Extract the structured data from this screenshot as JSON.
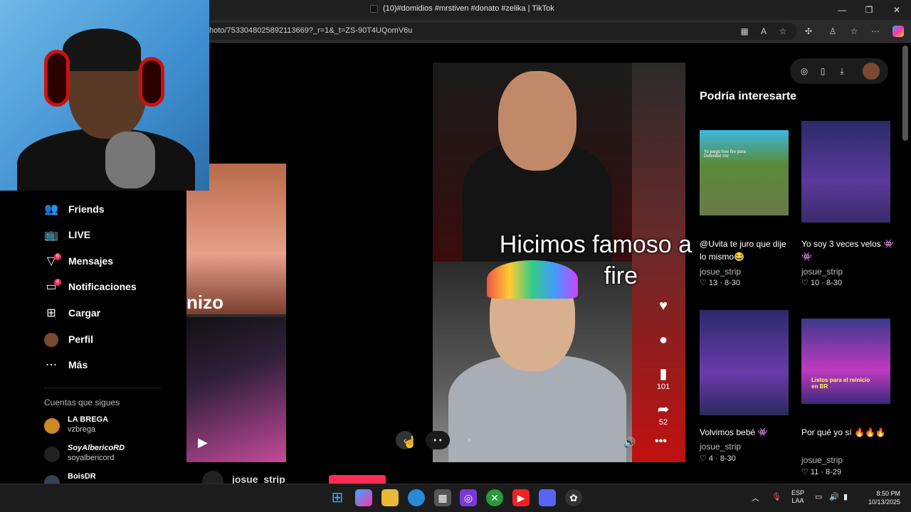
{
  "browser": {
    "tab_title": "(10)#domidios #mrstiven #donato #zelika | TikTok",
    "url": "hoto/7533048025892113669?_r=1&_t=ZS-90T4UQomV6u",
    "icons": [
      "tiktok-favicon",
      "minimize-icon",
      "maximize-icon",
      "close-icon",
      "split-screen-icon",
      "translate-icon",
      "favorite-star-icon",
      "extensions-icon",
      "profile-icon",
      "collections-icon",
      "more-icon",
      "copilot-icon"
    ]
  },
  "sidebar": {
    "items": [
      {
        "label": "Friends",
        "icon": "friends-icon"
      },
      {
        "label": "LIVE",
        "icon": "live-icon"
      },
      {
        "label": "Mensajes",
        "icon": "messages-icon",
        "badge": "6"
      },
      {
        "label": "Notificaciones",
        "icon": "notifications-icon",
        "badge": "4"
      },
      {
        "label": "Cargar",
        "icon": "upload-icon"
      },
      {
        "label": "Perfil",
        "icon": "profile-avatar"
      },
      {
        "label": "Más",
        "icon": "more-dots-icon"
      }
    ],
    "following_heading": "Cuentas que sigues",
    "accounts": [
      {
        "name": "LA BREGA",
        "handle": "vzbrega"
      },
      {
        "name": "SoyAlbericoRD",
        "handle": "soyalbericord"
      },
      {
        "name": "BoisDR",
        "handle": ""
      }
    ]
  },
  "video": {
    "caption_line1": "Hicimos famoso a",
    "caption_line2": "fire",
    "left_overlay_text": "nizo",
    "like_count": "",
    "comment_count": "",
    "save_count": "101",
    "share_count": "52",
    "author": "josue_strip"
  },
  "right_panel": {
    "title": "Podría interesarte",
    "cards": [
      {
        "caption": "@Uvita te juro que dije lo mismo😂",
        "author": "josue_strip",
        "likes": "13",
        "date": "8-30",
        "thumb_text": "Yo juego free fire para Defender me"
      },
      {
        "caption": "Yo soy 3 veces velos 👾👾",
        "author": "josue_strip",
        "likes": "10",
        "date": "8-30",
        "thumb_text": ""
      },
      {
        "caption": "Volvimos bebé 👾",
        "author": "josue_strip",
        "likes": "4",
        "date": "8-30",
        "thumb_text": ""
      },
      {
        "caption": "Por qué yo sí 🔥🔥🔥",
        "author": "josue_strip",
        "likes": "11",
        "date": "8-29",
        "thumb_text": "Listos para el reinicio en BR"
      }
    ]
  },
  "taskbar": {
    "lang_1": "ESP",
    "lang_2": "LAA",
    "time": "8:50 PM",
    "date": "10/13/2025",
    "apps": [
      "windows-start-icon",
      "copilot-icon",
      "file-explorer-icon",
      "edge-icon",
      "store-icon",
      "instagram-icon",
      "xbox-icon",
      "youtube-icon",
      "discord-icon",
      "chatgpt-icon"
    ]
  }
}
